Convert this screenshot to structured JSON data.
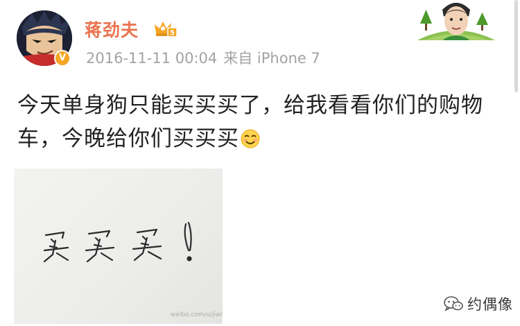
{
  "user": {
    "name": "蒋劲夫",
    "verified_badge": "V",
    "vip_level": "5",
    "name_color": "#eb7350"
  },
  "post": {
    "timestamp": "2016-11-11 00:04",
    "source": "来自 iPhone 7",
    "text": "今天单身狗只能买买买了，给我看看你们的购物车，今晚给你们买买买",
    "emoji": "smirk-face-emoji"
  },
  "photo": {
    "handwriting": "买买买！",
    "watermark": "weibo.com/u/jiangjinfu"
  },
  "watermark": {
    "account": "约偶像",
    "icon": "wechat-icon"
  }
}
